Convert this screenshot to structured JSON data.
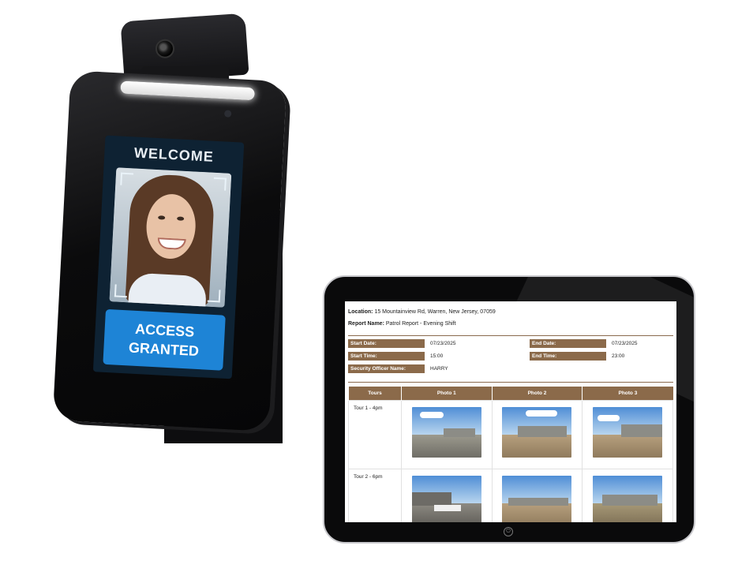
{
  "terminal": {
    "welcome": "WELCOME",
    "access_line1": "ACCESS",
    "access_line2": "GRANTED"
  },
  "report": {
    "location_label": "Location:",
    "location_value": "15 Mountainview Rd, Warren, New Jersey, 07059",
    "name_label": "Report Name:",
    "name_value": "Patrol Report - Evening Shift",
    "start_date_label": "Start Date:",
    "start_date": "07/23/2025",
    "end_date_label": "End Date:",
    "end_date": "07/23/2025",
    "start_time_label": "Start Time:",
    "start_time": "15:00",
    "end_time_label": "End Time:",
    "end_time": "23:00",
    "officer_label": "Security Officer Name:",
    "officer": "HARRY",
    "table": {
      "headers": [
        "Tours",
        "Photo 1",
        "Photo 2",
        "Photo 3"
      ],
      "rows": [
        {
          "tour": "Tour 1 - 4pm"
        },
        {
          "tour": "Tour 2 - 6pm"
        }
      ]
    }
  },
  "icons": {
    "power": "power-icon"
  }
}
